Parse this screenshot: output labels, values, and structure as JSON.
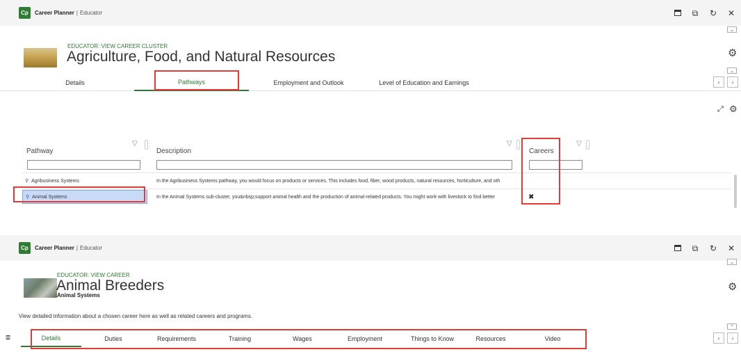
{
  "app": {
    "logo": "Cp",
    "name": "Career Planner",
    "separator": "|",
    "role": "Educator"
  },
  "window_controls": [
    "maximize-icon",
    "popout-icon",
    "refresh-icon",
    "close-icon"
  ],
  "top": {
    "eyebrow": "EDUCATOR: VIEW CAREER CLUSTER",
    "title": "Agriculture, Food, and Natural Resources",
    "tabs": [
      {
        "label": "Details",
        "active": false
      },
      {
        "label": "Pathways",
        "active": true
      },
      {
        "label": "Employment and Outlook",
        "active": false
      },
      {
        "label": "Level of Education and Earnings",
        "active": false
      }
    ],
    "grid": {
      "columns": [
        "Pathway",
        "Description",
        "Careers"
      ],
      "rows": [
        {
          "pathway": "Agribusiness Systems",
          "description": "In the Agribusiness Systems pathway, you would focus on products or services. This includes food, fiber, wood products, natural resources, horticulture, and oth",
          "careers_icon": ""
        },
        {
          "pathway": "Animal Systems",
          "description": "In the Animal Systems sub-cluster, you&nbsp;support animal health and the production of animal-related products. You might work with livestock to find better",
          "careers_icon": "tools-icon"
        }
      ]
    }
  },
  "bottom": {
    "eyebrow": "EDUCATOR: VIEW CAREER",
    "title": "Animal Breeders",
    "subtitle": "Animal Systems",
    "description": "View detailed information about a chosen career here as well as related careers and programs.",
    "tabs": [
      {
        "label": "Details",
        "active": true
      },
      {
        "label": "Duties",
        "active": false
      },
      {
        "label": "Requirements",
        "active": false
      },
      {
        "label": "Training",
        "active": false
      },
      {
        "label": "Wages",
        "active": false
      },
      {
        "label": "Employment",
        "active": false
      },
      {
        "label": "Things to Know",
        "active": false
      },
      {
        "label": "Resources",
        "active": false
      },
      {
        "label": "Video",
        "active": false
      }
    ]
  },
  "colors": {
    "accent": "#2e7d32",
    "highlight": "#e53935",
    "selected_row": "#c9daf8"
  }
}
